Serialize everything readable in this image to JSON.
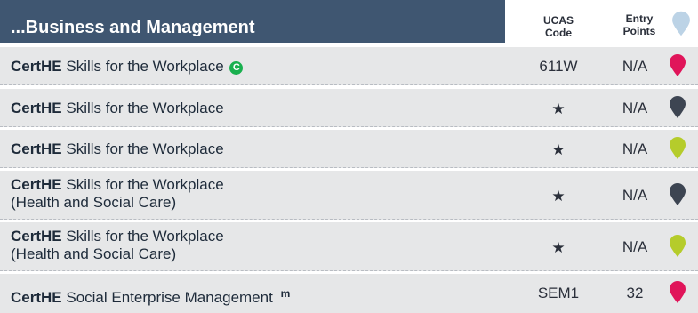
{
  "header": {
    "title": "...Business and Management",
    "ucas_line1": "UCAS",
    "ucas_line2": "Code",
    "entry_line1": "Entry",
    "entry_line2": "Points",
    "legend_pin_color": "#bcd3e6"
  },
  "colors": {
    "header_band": "#3f5671",
    "row_background": "#e6e7e8",
    "pin_pink": "#e0155a",
    "pin_slate": "#3d4552",
    "pin_lime": "#b5cc2b",
    "badge_green": "#19b04f"
  },
  "rows": [
    {
      "qualification": "CertHE",
      "course_line1": "Skills for the Workplace",
      "course_line2": "",
      "marker": "C",
      "marker_icon": "c-circle-icon",
      "ucas_code": "611W",
      "entry_points": "N/A",
      "pin_color": "#e0155a",
      "pin_icon": "map-pin-icon"
    },
    {
      "qualification": "CertHE",
      "course_line1": "Skills for the Workplace",
      "course_line2": "",
      "marker": "",
      "ucas_code": "★",
      "entry_points": "N/A",
      "pin_color": "#3d4552",
      "pin_icon": "map-pin-icon"
    },
    {
      "qualification": "CertHE",
      "course_line1": "Skills for the Workplace",
      "course_line2": "",
      "marker": "",
      "ucas_code": "★",
      "entry_points": "N/A",
      "pin_color": "#b5cc2b",
      "pin_icon": "map-pin-icon"
    },
    {
      "qualification": "CertHE",
      "course_line1": "Skills for the Workplace",
      "course_line2": "(Health and Social Care)",
      "marker": "",
      "ucas_code": "★",
      "entry_points": "N/A",
      "pin_color": "#3d4552",
      "pin_icon": "map-pin-icon"
    },
    {
      "qualification": "CertHE",
      "course_line1": "Skills for the Workplace",
      "course_line2": "(Health and Social Care)",
      "marker": "",
      "ucas_code": "★",
      "entry_points": "N/A",
      "pin_color": "#b5cc2b",
      "pin_icon": "map-pin-icon"
    },
    {
      "qualification": "CertHE",
      "course_line1": "Social Enterprise Management",
      "course_line2": "",
      "marker": "m",
      "marker_icon": "superscript-m",
      "ucas_code": "SEM1",
      "entry_points": "32",
      "pin_color": "#e0155a",
      "pin_icon": "map-pin-icon"
    }
  ]
}
